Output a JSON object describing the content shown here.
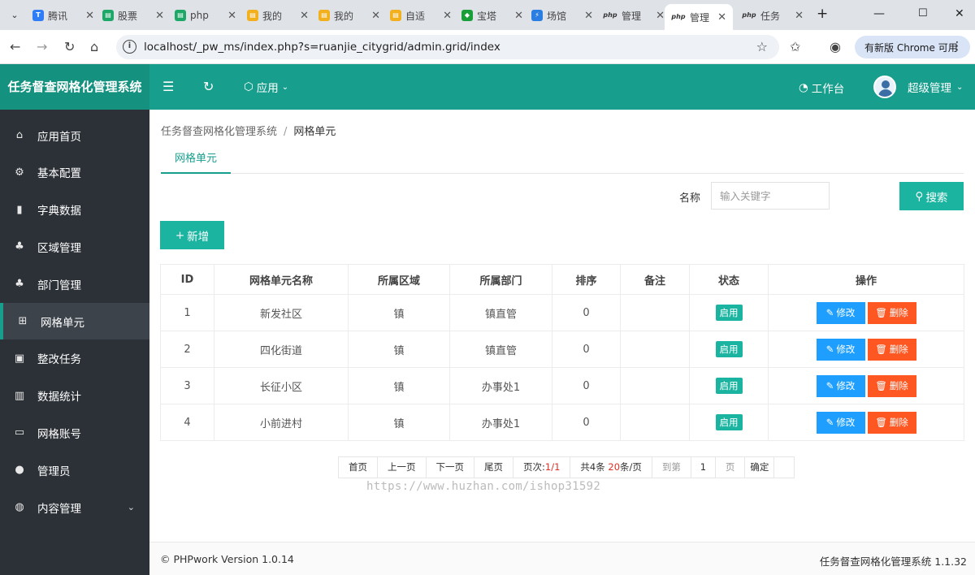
{
  "browser": {
    "tabs": [
      {
        "title": "腾讯",
        "color": "#2e7cf6",
        "glyph": "T"
      },
      {
        "title": "股票",
        "color": "#1ea868",
        "glyph": "▤"
      },
      {
        "title": "php",
        "color": "#1ea868",
        "glyph": "▤"
      },
      {
        "title": "我的",
        "color": "#f2b01e",
        "glyph": "▤"
      },
      {
        "title": "我的",
        "color": "#f2b01e",
        "glyph": "▤"
      },
      {
        "title": "自适",
        "color": "#f2b01e",
        "glyph": "▤"
      },
      {
        "title": "宝塔",
        "color": "#1a9e3a",
        "glyph": "◆"
      },
      {
        "title": "场馆",
        "color": "#2a7de1",
        "glyph": "⚡"
      },
      {
        "title": "管理",
        "color": "#555555",
        "glyph": "php"
      },
      {
        "title": "管理",
        "color": "#555555",
        "glyph": "php"
      },
      {
        "title": "任务",
        "color": "#555555",
        "glyph": "php"
      }
    ],
    "active_tab_index": 9,
    "url": "localhost/_pw_ms/index.php?s=ruanjie_citygrid/admin.grid/index",
    "update_label": "有新版 Chrome 可用"
  },
  "header": {
    "app_title": "任务督查网格化管理系统",
    "apps_label": "应用",
    "workbench_label": "工作台",
    "user_label": "超级管理"
  },
  "sidebar": {
    "items": [
      {
        "label": "应用首页",
        "icon": "⌂",
        "name": "home"
      },
      {
        "label": "基本配置",
        "icon": "⚙",
        "name": "config"
      },
      {
        "label": "字典数据",
        "icon": "▮",
        "name": "dictionary"
      },
      {
        "label": "区域管理",
        "icon": "♣",
        "name": "region"
      },
      {
        "label": "部门管理",
        "icon": "♣",
        "name": "department"
      },
      {
        "label": "网格单元",
        "icon": "⊞",
        "name": "grid-unit"
      },
      {
        "label": "整改任务",
        "icon": "▣",
        "name": "rectify-task"
      },
      {
        "label": "数据统计",
        "icon": "▥",
        "name": "statistics"
      },
      {
        "label": "网格账号",
        "icon": "▭",
        "name": "grid-account"
      },
      {
        "label": "管理员",
        "icon": "●",
        "name": "admin"
      },
      {
        "label": "内容管理",
        "icon": "◍",
        "name": "content"
      }
    ],
    "active_index": 5
  },
  "breadcrumb": {
    "root": "任务督查网格化管理系统",
    "separator": "/",
    "current": "网格单元"
  },
  "tab": {
    "label": "网格单元"
  },
  "search": {
    "label": "名称",
    "placeholder": "输入关键字",
    "value": "",
    "button_label": "搜索"
  },
  "toolbar": {
    "add_label": "新增"
  },
  "table": {
    "columns": [
      "ID",
      "网格单元名称",
      "所属区域",
      "所属部门",
      "排序",
      "备注",
      "状态",
      "操作"
    ],
    "rows": [
      {
        "id": "1",
        "name": "新发社区",
        "region": "镇",
        "dept": "镇直管",
        "sort": "0",
        "remark": "",
        "status": "启用"
      },
      {
        "id": "2",
        "name": "四化街道",
        "region": "镇",
        "dept": "镇直管",
        "sort": "0",
        "remark": "",
        "status": "启用"
      },
      {
        "id": "3",
        "name": "长征小区",
        "region": "镇",
        "dept": "办事处1",
        "sort": "0",
        "remark": "",
        "status": "启用"
      },
      {
        "id": "4",
        "name": "小前进村",
        "region": "镇",
        "dept": "办事处1",
        "sort": "0",
        "remark": "",
        "status": "启用"
      }
    ],
    "edit_label": "修改",
    "delete_label": "删除"
  },
  "pager": {
    "first": "首页",
    "prev": "上一页",
    "next": "下一页",
    "last": "尾页",
    "page_info_prefix": "页次:",
    "page_info_value": "1/1",
    "total_prefix": "共4条 ",
    "per_page": "20",
    "per_page_suffix": "条/页",
    "goto_label": "到第",
    "goto_value": "1",
    "page_suffix": "页",
    "confirm": "确定"
  },
  "watermark": "https://www.huzhan.com/ishop31592",
  "footer": {
    "left": "© PHPwork Version 1.0.14",
    "right": "任务督查网格化管理系统 1.1.32"
  }
}
